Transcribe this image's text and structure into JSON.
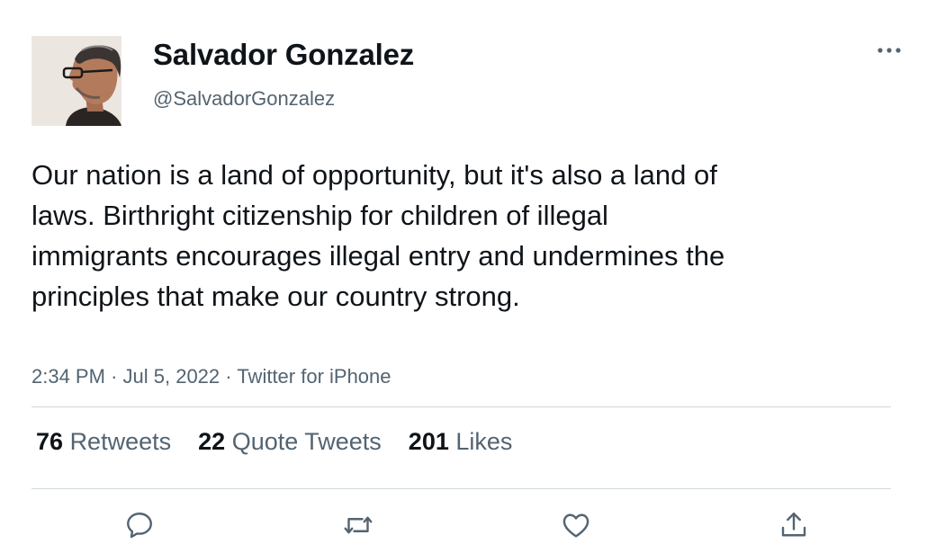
{
  "tweet": {
    "author_name": "Salvador Gonzalez",
    "handle": "@SalvadorGonzalez",
    "text": "Our nation is a land of opportunity, but it's also a land of laws. Birthright citizenship for children of illegal immigrants encourages illegal entry and undermines the principles that make our country strong.",
    "time": "2:34 PM",
    "separator": "·",
    "date": "Jul 5, 2022",
    "source": "Twitter for iPhone"
  },
  "stats": {
    "retweets": {
      "count": "76",
      "label": "Retweets"
    },
    "quotes": {
      "count": "22",
      "label": "Quote Tweets"
    },
    "likes": {
      "count": "201",
      "label": "Likes"
    }
  },
  "actions": {
    "reply_icon": "reply-icon",
    "retweet_icon": "retweet-icon",
    "like_icon": "heart-icon",
    "share_icon": "share-icon"
  },
  "colors": {
    "text": "#0f1419",
    "secondary": "#536471",
    "divider": "#cfd9de"
  }
}
